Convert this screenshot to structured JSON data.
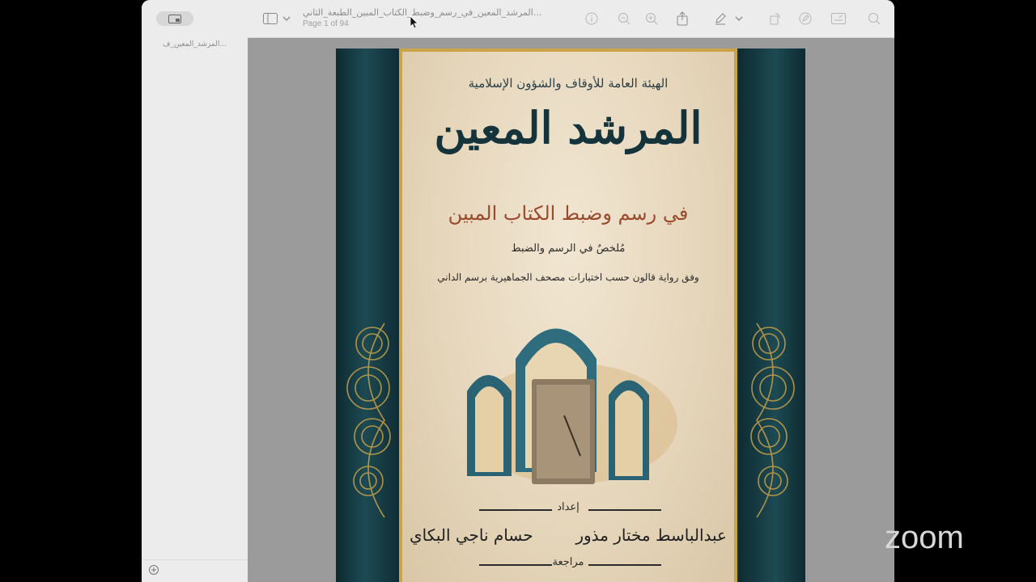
{
  "window": {
    "document_title": "المرشد_المعين_في_رسم_وضبط_الكتاب_المبين_الطبعة_الثاني...",
    "page_indicator": "Page 1 of 94"
  },
  "sidebar": {
    "thumbnail_label": "المرشد_المعين_ف..."
  },
  "toolbar": {
    "icons": [
      "sidebar-icon",
      "chevron-down-icon",
      "info-icon",
      "zoom-out-icon",
      "zoom-in-icon",
      "share-icon",
      "markup-pen-icon",
      "chevron-down-icon",
      "rotate-icon",
      "annotate-icon",
      "form-fill-icon",
      "search-icon"
    ]
  },
  "cover": {
    "authority": "الهيئة العامة للأوقاف والشؤون الإسلامية",
    "title": "المرشد المعين",
    "subtitle": "في رسم وضبط الكتاب المبين",
    "line1": "مُلخصٌ في الرسم والضبط",
    "line2": "وفق رواية قالون حسب اختيارات مصحف الجماهيرية برسم الداني",
    "prepared_label": "إعداد",
    "author1": "عبدالباسط مختار مذور",
    "author2": "حسام ناجي البكاي",
    "review_label": "مراجعة"
  },
  "overlay": {
    "brand": "zoom"
  },
  "colors": {
    "curtain": "#14323a",
    "gold": "#c9a24a",
    "parchment": "#e9dcc4",
    "title_teal": "#14333b",
    "subtitle_brown": "#9a4a2c"
  }
}
